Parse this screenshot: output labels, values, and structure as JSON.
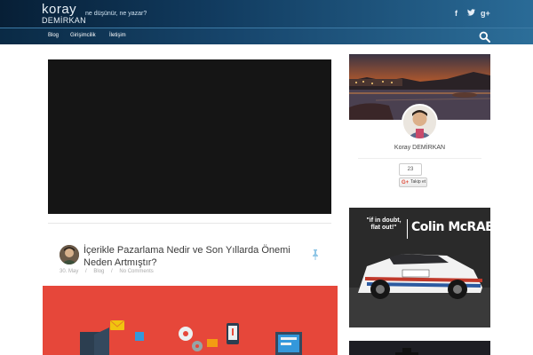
{
  "header": {
    "logo_line1": "koray",
    "logo_line2": "DEMİRKAN",
    "tagline": "ne düşünür, ne yazar?",
    "social": [
      "f",
      "t",
      "g+"
    ]
  },
  "nav": {
    "items": [
      "Blog",
      "Girişimcilik",
      "İletişim"
    ]
  },
  "post": {
    "title": "İçerikle Pazarlama Nedir ve Son Yıllarda Önemi Neden Artmıştır?",
    "date": "30. May",
    "category": "Blog",
    "comments": "No Comments",
    "separator": "/"
  },
  "profile": {
    "name": "Koray DEMİRKAN",
    "follower_count": "23",
    "follow_label": "Takip et"
  },
  "ad": {
    "quote": "\"if in doubt, flat out!\"",
    "name": "Colin McRAE"
  },
  "icons": [
    "facebook-icon",
    "twitter-icon",
    "google-plus-icon",
    "search-icon",
    "pin-icon",
    "google-plus-badge-icon"
  ]
}
